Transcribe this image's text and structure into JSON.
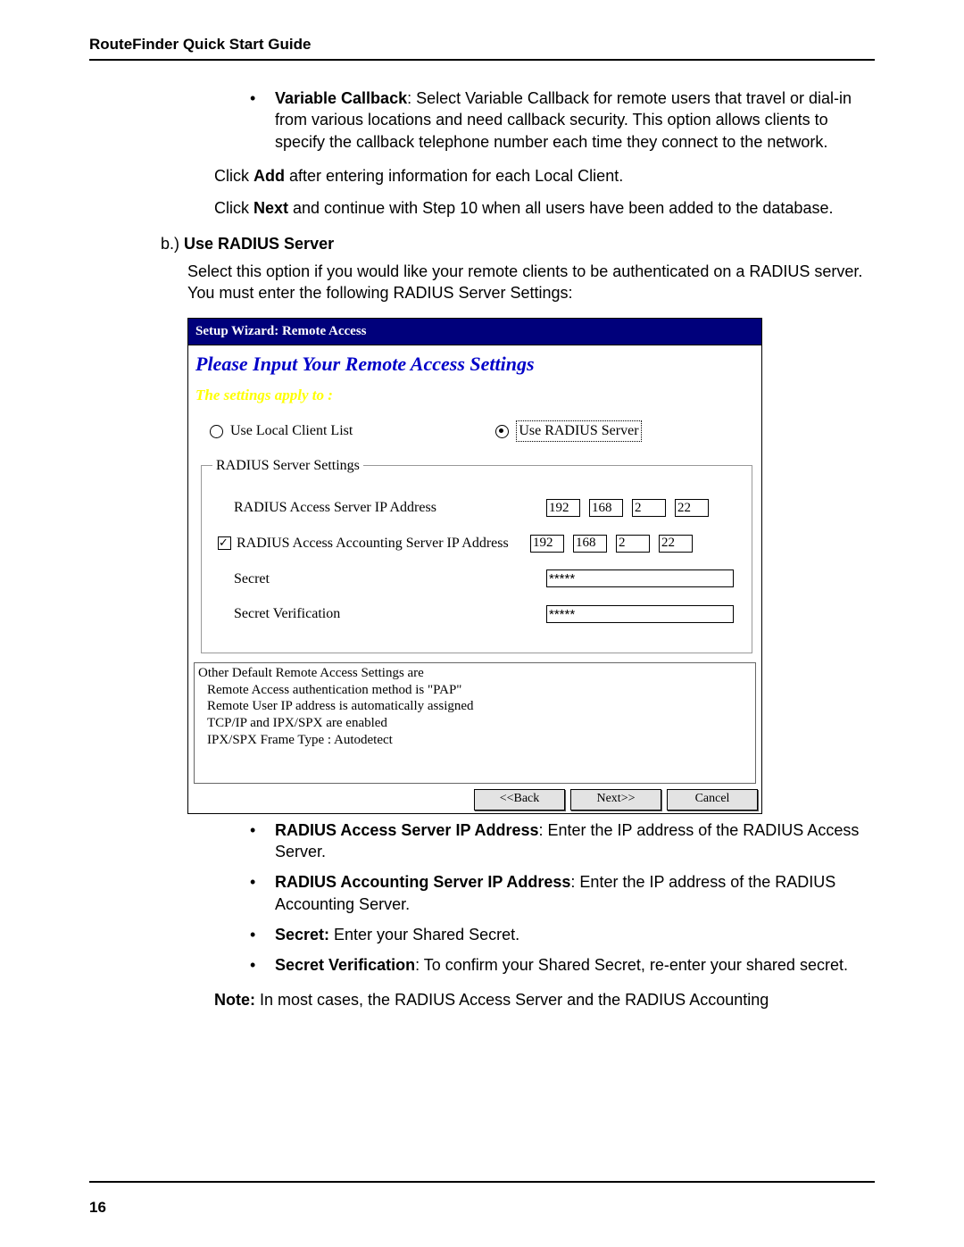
{
  "header": {
    "title": "RouteFinder Quick Start Guide"
  },
  "page_number": "16",
  "variable_callback": {
    "title": "Variable Callback",
    "text": ": Select Variable Callback for remote users that travel or dial-in from various locations and need callback security.  This option allows clients to specify the callback telephone number each time they connect to the network."
  },
  "click_add_pre": "Click ",
  "click_add_bold": "Add",
  "click_add_post": " after entering information for each Local Client.",
  "click_next_pre": "Click ",
  "click_next_bold": "Next",
  "click_next_post": " and continue with Step 10 when all users have been added to the database.",
  "section_b": {
    "prefix": "b.) ",
    "title": "Use RADIUS Server",
    "text": "Select this option if you would like your remote clients to be authenticated on a RADIUS server.  You must enter the following RADIUS Server Settings:"
  },
  "wizard": {
    "title": "Setup Wizard: Remote Access",
    "heading": "Please Input Your Remote Access Settings",
    "sub": "The settings apply to :",
    "radio1": "Use Local Client List",
    "radio2": "Use RADIUS Server",
    "fieldset_legend": "RADIUS Server Settings",
    "row1_label": "RADIUS Access Server IP Address",
    "row1_ip": [
      "192",
      "168",
      "2",
      "22"
    ],
    "row2_label": "RADIUS Access Accounting Server IP Address",
    "row2_ip": [
      "192",
      "168",
      "2",
      "22"
    ],
    "row3_label": "Secret",
    "row3_value": "*****",
    "row4_label": "Secret Verification",
    "row4_value": "*****",
    "infobox": [
      "Other Default Remote Access Settings are",
      "Remote Access authentication method is \"PAP\"",
      "Remote User IP address is automatically assigned",
      "TCP/IP and IPX/SPX are enabled",
      "IPX/SPX Frame Type : Autodetect"
    ],
    "btn_back": "<<Back",
    "btn_next": "Next>>",
    "btn_cancel": "Cancel"
  },
  "lower_bullets": [
    {
      "title": "RADIUS Access Server IP Address",
      "text": ": Enter the IP address of the RADIUS Access Server."
    },
    {
      "title": "RADIUS Accounting Server IP Address",
      "text": ": Enter the IP address of the RADIUS Accounting Server."
    },
    {
      "title": "Secret:",
      "text": " Enter your Shared Secret."
    },
    {
      "title": "Secret Verification",
      "text": ": To confirm your Shared Secret, re-enter your shared secret."
    }
  ],
  "note_pre": "Note:",
  "note_post": " In most cases, the RADIUS Access Server and the RADIUS Accounting"
}
